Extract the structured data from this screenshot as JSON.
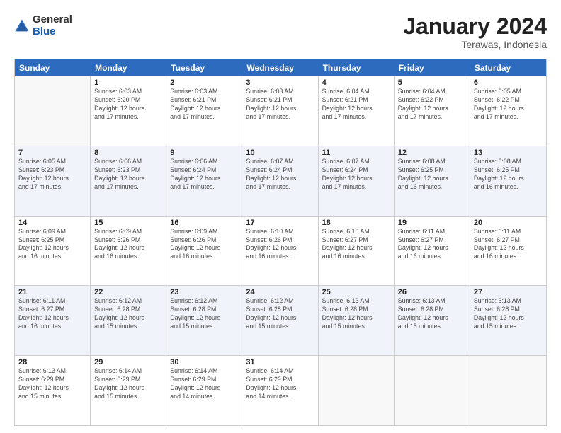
{
  "logo": {
    "general": "General",
    "blue": "Blue"
  },
  "title": "January 2024",
  "subtitle": "Terawas, Indonesia",
  "days": [
    "Sunday",
    "Monday",
    "Tuesday",
    "Wednesday",
    "Thursday",
    "Friday",
    "Saturday"
  ],
  "rows": [
    [
      {
        "day": "",
        "info": ""
      },
      {
        "day": "1",
        "info": "Sunrise: 6:03 AM\nSunset: 6:20 PM\nDaylight: 12 hours\nand 17 minutes."
      },
      {
        "day": "2",
        "info": "Sunrise: 6:03 AM\nSunset: 6:21 PM\nDaylight: 12 hours\nand 17 minutes."
      },
      {
        "day": "3",
        "info": "Sunrise: 6:03 AM\nSunset: 6:21 PM\nDaylight: 12 hours\nand 17 minutes."
      },
      {
        "day": "4",
        "info": "Sunrise: 6:04 AM\nSunset: 6:21 PM\nDaylight: 12 hours\nand 17 minutes."
      },
      {
        "day": "5",
        "info": "Sunrise: 6:04 AM\nSunset: 6:22 PM\nDaylight: 12 hours\nand 17 minutes."
      },
      {
        "day": "6",
        "info": "Sunrise: 6:05 AM\nSunset: 6:22 PM\nDaylight: 12 hours\nand 17 minutes."
      }
    ],
    [
      {
        "day": "7",
        "info": "Sunrise: 6:05 AM\nSunset: 6:23 PM\nDaylight: 12 hours\nand 17 minutes."
      },
      {
        "day": "8",
        "info": "Sunrise: 6:06 AM\nSunset: 6:23 PM\nDaylight: 12 hours\nand 17 minutes."
      },
      {
        "day": "9",
        "info": "Sunrise: 6:06 AM\nSunset: 6:24 PM\nDaylight: 12 hours\nand 17 minutes."
      },
      {
        "day": "10",
        "info": "Sunrise: 6:07 AM\nSunset: 6:24 PM\nDaylight: 12 hours\nand 17 minutes."
      },
      {
        "day": "11",
        "info": "Sunrise: 6:07 AM\nSunset: 6:24 PM\nDaylight: 12 hours\nand 17 minutes."
      },
      {
        "day": "12",
        "info": "Sunrise: 6:08 AM\nSunset: 6:25 PM\nDaylight: 12 hours\nand 16 minutes."
      },
      {
        "day": "13",
        "info": "Sunrise: 6:08 AM\nSunset: 6:25 PM\nDaylight: 12 hours\nand 16 minutes."
      }
    ],
    [
      {
        "day": "14",
        "info": "Sunrise: 6:09 AM\nSunset: 6:25 PM\nDaylight: 12 hours\nand 16 minutes."
      },
      {
        "day": "15",
        "info": "Sunrise: 6:09 AM\nSunset: 6:26 PM\nDaylight: 12 hours\nand 16 minutes."
      },
      {
        "day": "16",
        "info": "Sunrise: 6:09 AM\nSunset: 6:26 PM\nDaylight: 12 hours\nand 16 minutes."
      },
      {
        "day": "17",
        "info": "Sunrise: 6:10 AM\nSunset: 6:26 PM\nDaylight: 12 hours\nand 16 minutes."
      },
      {
        "day": "18",
        "info": "Sunrise: 6:10 AM\nSunset: 6:27 PM\nDaylight: 12 hours\nand 16 minutes."
      },
      {
        "day": "19",
        "info": "Sunrise: 6:11 AM\nSunset: 6:27 PM\nDaylight: 12 hours\nand 16 minutes."
      },
      {
        "day": "20",
        "info": "Sunrise: 6:11 AM\nSunset: 6:27 PM\nDaylight: 12 hours\nand 16 minutes."
      }
    ],
    [
      {
        "day": "21",
        "info": "Sunrise: 6:11 AM\nSunset: 6:27 PM\nDaylight: 12 hours\nand 16 minutes."
      },
      {
        "day": "22",
        "info": "Sunrise: 6:12 AM\nSunset: 6:28 PM\nDaylight: 12 hours\nand 15 minutes."
      },
      {
        "day": "23",
        "info": "Sunrise: 6:12 AM\nSunset: 6:28 PM\nDaylight: 12 hours\nand 15 minutes."
      },
      {
        "day": "24",
        "info": "Sunrise: 6:12 AM\nSunset: 6:28 PM\nDaylight: 12 hours\nand 15 minutes."
      },
      {
        "day": "25",
        "info": "Sunrise: 6:13 AM\nSunset: 6:28 PM\nDaylight: 12 hours\nand 15 minutes."
      },
      {
        "day": "26",
        "info": "Sunrise: 6:13 AM\nSunset: 6:28 PM\nDaylight: 12 hours\nand 15 minutes."
      },
      {
        "day": "27",
        "info": "Sunrise: 6:13 AM\nSunset: 6:28 PM\nDaylight: 12 hours\nand 15 minutes."
      }
    ],
    [
      {
        "day": "28",
        "info": "Sunrise: 6:13 AM\nSunset: 6:29 PM\nDaylight: 12 hours\nand 15 minutes."
      },
      {
        "day": "29",
        "info": "Sunrise: 6:14 AM\nSunset: 6:29 PM\nDaylight: 12 hours\nand 15 minutes."
      },
      {
        "day": "30",
        "info": "Sunrise: 6:14 AM\nSunset: 6:29 PM\nDaylight: 12 hours\nand 14 minutes."
      },
      {
        "day": "31",
        "info": "Sunrise: 6:14 AM\nSunset: 6:29 PM\nDaylight: 12 hours\nand 14 minutes."
      },
      {
        "day": "",
        "info": ""
      },
      {
        "day": "",
        "info": ""
      },
      {
        "day": "",
        "info": ""
      }
    ]
  ],
  "alt_rows": [
    1,
    3
  ]
}
